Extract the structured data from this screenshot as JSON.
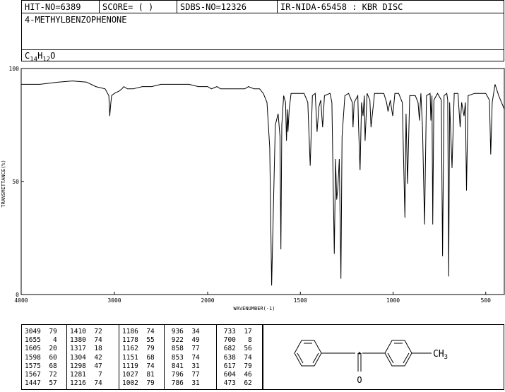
{
  "header": {
    "hit_no": "HIT-NO=6389",
    "score": "SCORE=  (  )",
    "sdbs_no": "SDBS-NO=12326",
    "ir_info": "IR-NIDA-65458 : KBR DISC"
  },
  "compound": {
    "name": "4-METHYLBENZOPHENONE",
    "formula_c": "C",
    "formula_c_sub": "14",
    "formula_h": "H",
    "formula_h_sub": "12",
    "formula_o": "O"
  },
  "structure": {
    "carbonyl_label": "O",
    "methyl_label": "CH",
    "methyl_sub": "3"
  },
  "chart_data": {
    "type": "line",
    "title": "",
    "xlabel": "WAVENUMBER(-1)",
    "ylabel": "TRANSMITTANCE(%)",
    "xlim": [
      4000,
      400
    ],
    "ylim": [
      0,
      100
    ],
    "x_ticks": [
      4000,
      3000,
      2000,
      1500,
      1000,
      500
    ],
    "x_tick_labels": [
      "4000",
      "3000",
      "2000",
      "1500",
      "1000",
      "500"
    ],
    "y_ticks": [
      0,
      50,
      100
    ],
    "y_tick_labels": [
      "0",
      "50",
      "100"
    ],
    "series": [
      {
        "x": [
          4000,
          3800,
          3600,
          3450,
          3300,
          3200,
          3100,
          3060,
          3050,
          3040,
          3030,
          3000,
          2950,
          2920,
          2900,
          2860,
          2800,
          2700,
          2600,
          2500,
          2400,
          2200,
          2100,
          2000,
          1980,
          1950,
          1930,
          1900,
          1850,
          1800,
          1780,
          1750,
          1720,
          1700,
          1680,
          1665,
          1655,
          1645,
          1635,
          1620,
          1610,
          1605,
          1600,
          1590,
          1580,
          1575,
          1570,
          1567,
          1560,
          1550,
          1540,
          1500,
          1480,
          1460,
          1447,
          1435,
          1420,
          1410,
          1400,
          1390,
          1380,
          1370,
          1340,
          1330,
          1317,
          1310,
          1304,
          1298,
          1290,
          1281,
          1275,
          1260,
          1240,
          1220,
          1216,
          1210,
          1190,
          1186,
          1178,
          1170,
          1162,
          1155,
          1151,
          1140,
          1125,
          1119,
          1100,
          1080,
          1050,
          1035,
          1027,
          1015,
          1002,
          990,
          970,
          950,
          936,
          930,
          922,
          910,
          880,
          865,
          858,
          850,
          841,
          830,
          820,
          800,
          796,
          790,
          786,
          780,
          760,
          740,
          733,
          725,
          710,
          705,
          700,
          695,
          682,
          670,
          660,
          650,
          638,
          630,
          617,
          610,
          604,
          595,
          560,
          540,
          500,
          480,
          473,
          465,
          450,
          430,
          400
        ],
        "y": [
          93,
          93,
          94,
          94.5,
          94,
          92,
          91,
          88,
          79,
          84,
          88,
          89,
          90,
          91,
          92,
          91,
          91,
          92,
          92,
          93,
          93,
          93,
          92,
          92,
          91,
          92,
          91,
          91,
          91,
          91,
          92,
          91,
          91,
          89,
          85,
          65,
          4,
          40,
          75,
          80,
          70,
          20,
          75,
          88,
          85,
          68,
          82,
          72,
          82,
          89,
          89,
          89,
          89,
          85,
          57,
          88,
          89,
          72,
          83,
          86,
          74,
          88,
          89,
          85,
          18,
          60,
          42,
          47,
          60,
          7,
          70,
          88,
          89,
          85,
          74,
          85,
          88,
          74,
          55,
          85,
          79,
          88,
          68,
          89,
          86,
          74,
          89,
          89,
          89,
          85,
          81,
          86,
          79,
          89,
          89,
          85,
          34,
          80,
          49,
          88,
          88,
          85,
          77,
          89,
          74,
          31,
          88,
          89,
          77,
          88,
          31,
          86,
          89,
          86,
          17,
          88,
          89,
          86,
          8,
          85,
          56,
          89,
          89,
          89,
          74,
          85,
          79,
          85,
          46,
          88,
          89,
          89,
          89,
          86,
          62,
          85,
          93,
          88,
          82
        ]
      }
    ],
    "peak_table": {
      "columns": [
        [
          [
            "3049",
            "79"
          ],
          [
            "1655",
            "4"
          ],
          [
            "1605",
            "20"
          ],
          [
            "1598",
            "60"
          ],
          [
            "1575",
            "68"
          ],
          [
            "1567",
            "72"
          ],
          [
            "1447",
            "57"
          ]
        ],
        [
          [
            "1410",
            "72"
          ],
          [
            "1380",
            "74"
          ],
          [
            "1317",
            "18"
          ],
          [
            "1304",
            "42"
          ],
          [
            "1298",
            "47"
          ],
          [
            "1281",
            "7"
          ],
          [
            "1216",
            "74"
          ]
        ],
        [
          [
            "1186",
            "74"
          ],
          [
            "1178",
            "55"
          ],
          [
            "1162",
            "79"
          ],
          [
            "1151",
            "68"
          ],
          [
            "1119",
            "74"
          ],
          [
            "1027",
            "81"
          ],
          [
            "1002",
            "79"
          ]
        ],
        [
          [
            "936",
            "34"
          ],
          [
            "922",
            "49"
          ],
          [
            "858",
            "77"
          ],
          [
            "853",
            "74"
          ],
          [
            "841",
            "31"
          ],
          [
            "796",
            "77"
          ],
          [
            "786",
            "31"
          ]
        ],
        [
          [
            "733",
            "17"
          ],
          [
            "700",
            "8"
          ],
          [
            "682",
            "56"
          ],
          [
            "638",
            "74"
          ],
          [
            "617",
            "79"
          ],
          [
            "604",
            "46"
          ],
          [
            "473",
            "62"
          ]
        ]
      ]
    }
  }
}
